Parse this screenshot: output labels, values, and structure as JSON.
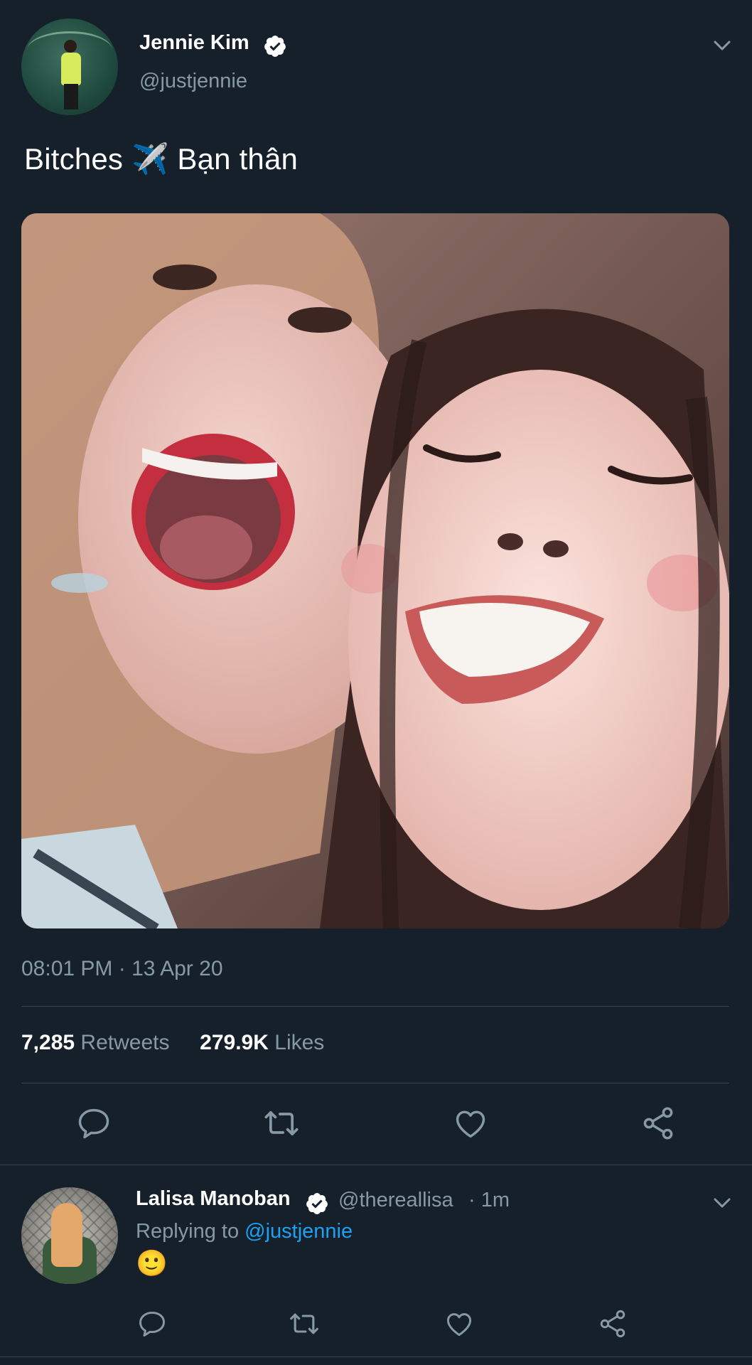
{
  "tweet": {
    "author_name": "Jennie Kim",
    "author_handle": "@justjennie",
    "text": "Bitches ✈️ Bạn thân",
    "timestamp": "08:01 PM · 13 Apr 20",
    "retweets_count": "7,285",
    "retweets_label": "Retweets",
    "likes_count": "279.9K",
    "likes_label": "Likes",
    "verified": true
  },
  "reply": {
    "author_name": "Lalisa Manoban",
    "author_handle": "@thereallisa",
    "time": "· 1m",
    "replying_prefix": "Replying to",
    "replying_mention": "@justjennie",
    "text": "🙂",
    "verified": true
  },
  "colors": {
    "background": "#15202b",
    "secondary_text": "#8899a6",
    "divider": "#38444d",
    "link": "#1da1f2"
  },
  "icons": {
    "chevron": "chevron-down-icon",
    "verified": "verified-badge-icon",
    "reply": "reply-icon",
    "retweet": "retweet-icon",
    "like": "heart-icon",
    "share": "share-icon"
  }
}
